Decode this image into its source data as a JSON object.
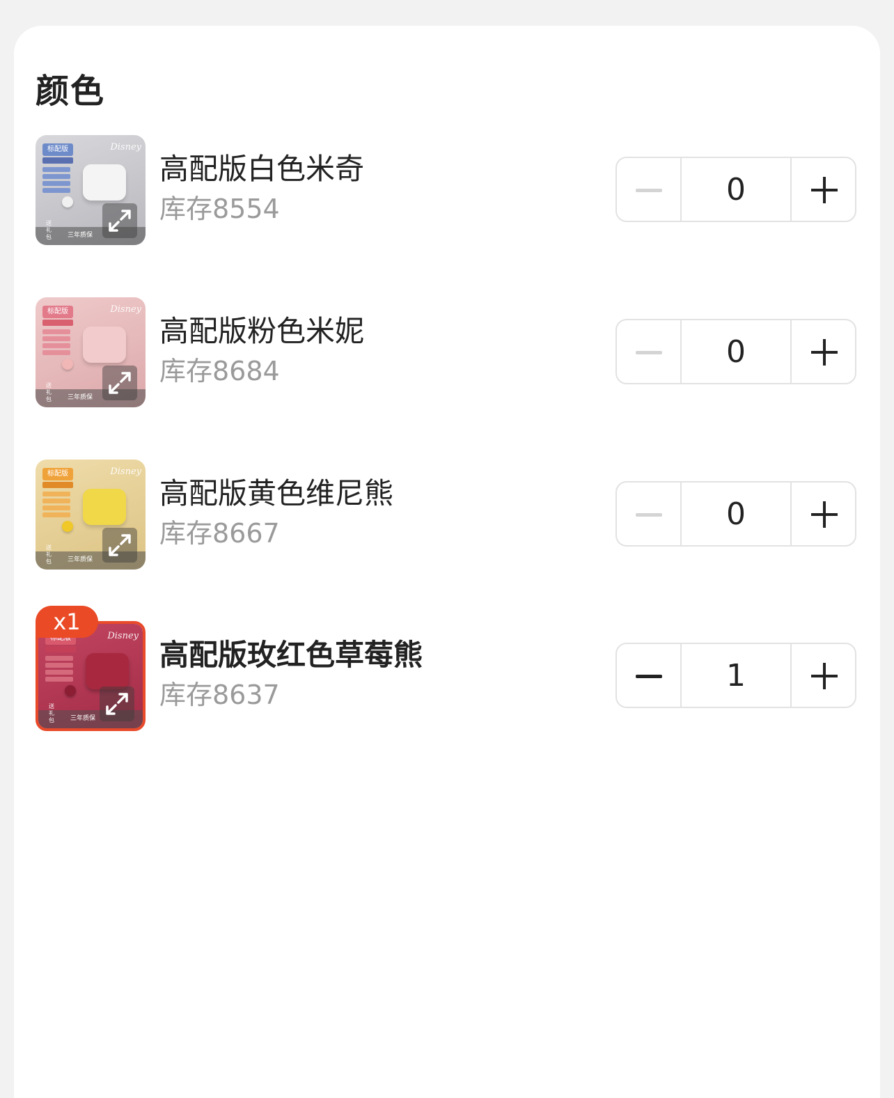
{
  "section": {
    "title": "颜色"
  },
  "items": [
    {
      "name": "高配版白色米奇",
      "stock": "库存8554",
      "quantity": "0",
      "selected": false,
      "thumb_colors": {
        "bg": "#c7c7cb",
        "tag": "#6e8bc9",
        "case": "#f4f4f4",
        "ball": "#f0f0f0"
      }
    },
    {
      "name": "高配版粉色米妮",
      "stock": "库存8684",
      "quantity": "0",
      "selected": false,
      "thumb_colors": {
        "bg": "#e8bcbc",
        "tag": "#e27a8a",
        "case": "#f2cccc",
        "ball": "#f1b6b6"
      }
    },
    {
      "name": "高配版黄色维尼熊",
      "stock": "库存8667",
      "quantity": "0",
      "selected": false,
      "thumb_colors": {
        "bg": "#e9d49a",
        "tag": "#f0a23a",
        "case": "#f1d848",
        "ball": "#f0c828"
      }
    },
    {
      "name": "高配版玫红色草莓熊",
      "stock": "库存8637",
      "quantity": "1",
      "selected": true,
      "badge": "x1",
      "thumb_colors": {
        "bg": "#b33a55",
        "tag": "#d95a6c",
        "case": "#a8283f",
        "ball": "#8c1e34"
      }
    }
  ],
  "thumb_text": {
    "tag": "标配版",
    "logo": "Disney",
    "strip": "三年质保",
    "gift": "送礼包"
  },
  "colors": {
    "accent": "#ea4a25",
    "minus_disabled": "#d4d4d4",
    "minus_enabled": "#222222"
  }
}
